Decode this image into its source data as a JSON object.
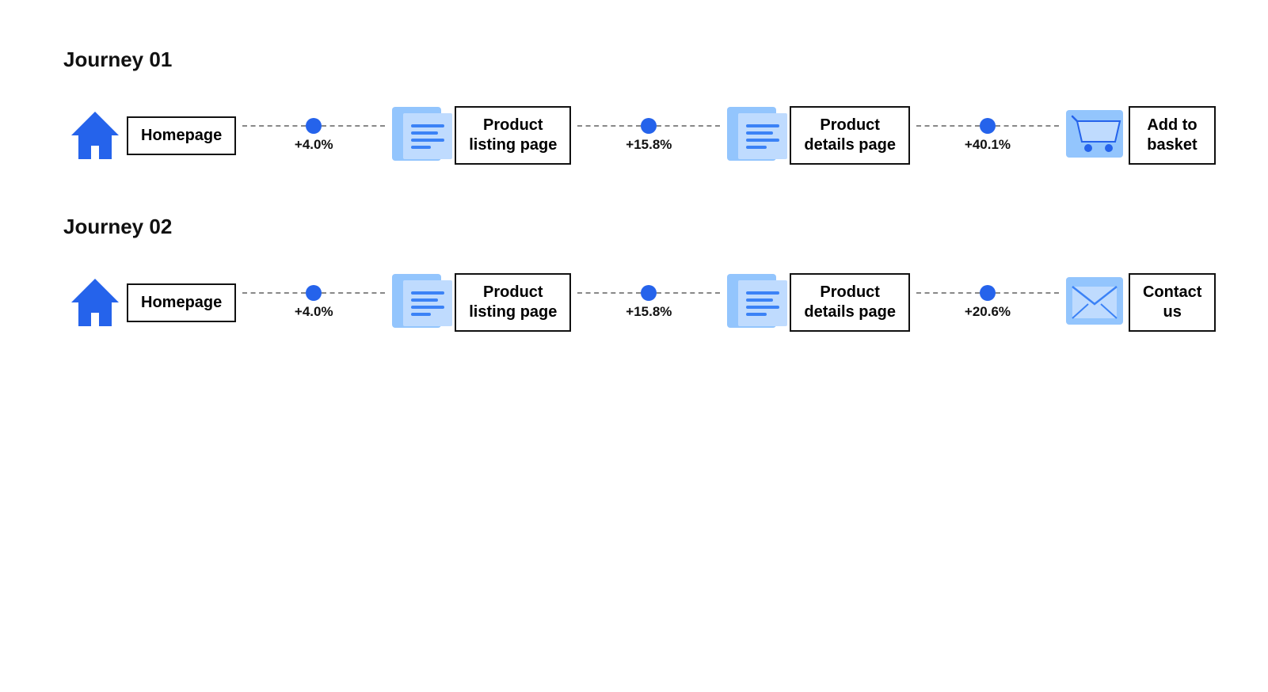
{
  "journeys": [
    {
      "id": "journey-01",
      "title": "Journey 01",
      "steps": [
        {
          "id": "homepage-1",
          "label": "Homepage",
          "icon": "home"
        },
        {
          "id": "product-listing-1",
          "label": "Product\nlisting page",
          "icon": "page"
        },
        {
          "id": "product-details-1",
          "label": "Product\ndetails page",
          "icon": "page"
        },
        {
          "id": "add-basket-1",
          "label": "Add to\nbasket",
          "icon": "cart"
        }
      ],
      "connectors": [
        {
          "id": "conn-1-1",
          "percent": "+4.0%"
        },
        {
          "id": "conn-1-2",
          "percent": "+15.8%"
        },
        {
          "id": "conn-1-3",
          "percent": "+40.1%"
        }
      ]
    },
    {
      "id": "journey-02",
      "title": "Journey 02",
      "steps": [
        {
          "id": "homepage-2",
          "label": "Homepage",
          "icon": "home"
        },
        {
          "id": "product-listing-2",
          "label": "Product\nlisting page",
          "icon": "page"
        },
        {
          "id": "product-details-2",
          "label": "Product\ndetails page",
          "icon": "page"
        },
        {
          "id": "contact-us-2",
          "label": "Contact\nus",
          "icon": "envelope"
        }
      ],
      "connectors": [
        {
          "id": "conn-2-1",
          "percent": "+4.0%"
        },
        {
          "id": "conn-2-2",
          "percent": "+15.8%"
        },
        {
          "id": "conn-2-3",
          "percent": "+20.6%"
        }
      ]
    }
  ]
}
